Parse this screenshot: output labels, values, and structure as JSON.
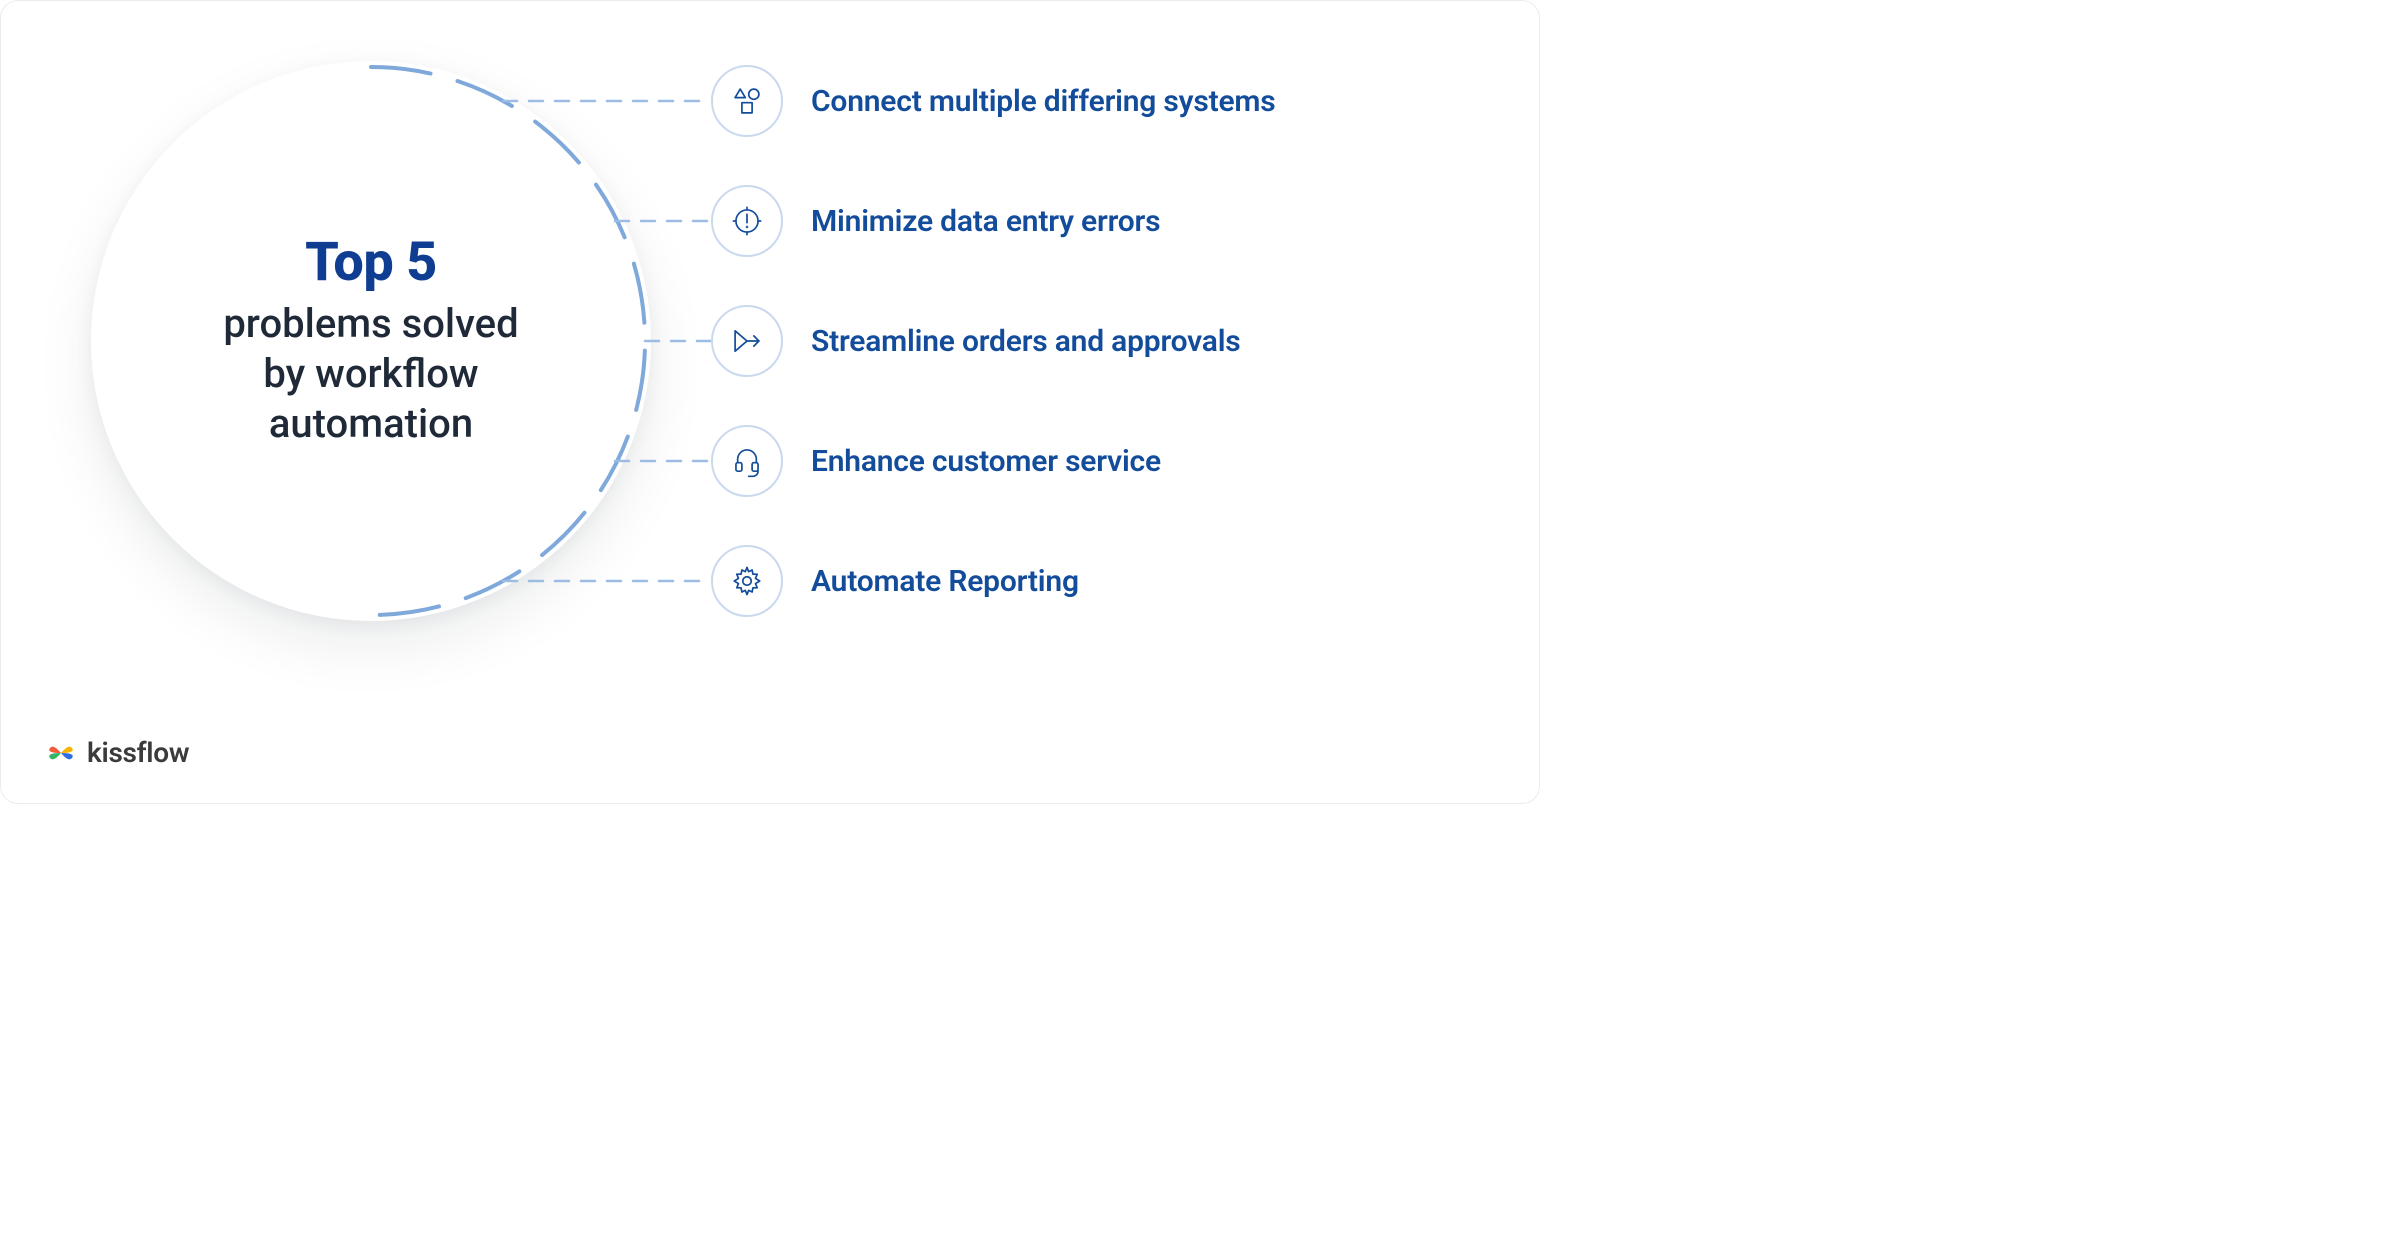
{
  "hub": {
    "title_top": "Top 5",
    "subtitle_line1": "problems solved",
    "subtitle_line2": "by workflow",
    "subtitle_line3": "automation"
  },
  "items": [
    {
      "icon": "shapes-icon",
      "label": "Connect multiple differing systems"
    },
    {
      "icon": "alert-icon",
      "label": "Minimize data entry errors"
    },
    {
      "icon": "flow-icon",
      "label": "Streamline orders and approvals"
    },
    {
      "icon": "headset-icon",
      "label": "Enhance customer service"
    },
    {
      "icon": "gear-icon",
      "label": "Automate Reporting"
    }
  ],
  "brand": {
    "name": "kissflow"
  },
  "colors": {
    "primary": "#134C9A",
    "hub_title": "#0F3D91",
    "hub_sub": "#1F2937",
    "badge_border": "#C9D9EE",
    "arc": "#7FA8DB",
    "dash": "#9DBCE3"
  }
}
